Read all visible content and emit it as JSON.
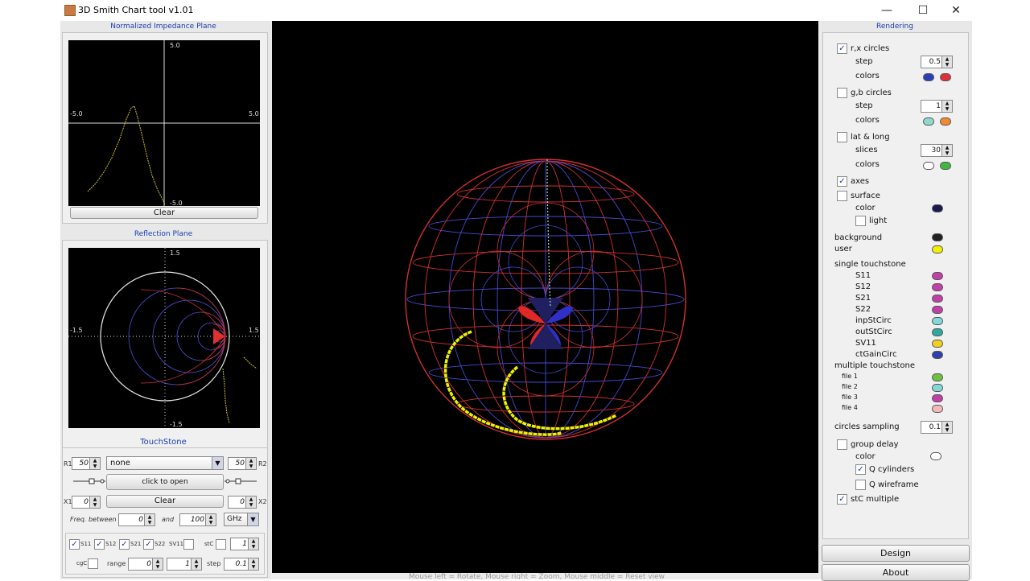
{
  "window": {
    "title": "3D Smith Chart tool v1.01",
    "controls": {
      "minimize": "—",
      "maximize": "☐",
      "close": "✕"
    }
  },
  "impedance_panel": {
    "title": "Normalized Impedance Plane",
    "ticks": {
      "top": "5.0",
      "bottom": "-5.0",
      "left": "-5.0",
      "right": "5.0"
    },
    "clear_label": "Clear"
  },
  "reflection_panel": {
    "title": "Reflection Plane",
    "ticks": {
      "top": "1.5",
      "bottom": "-1.5",
      "left": "-1.5",
      "right": "1.5"
    }
  },
  "touchstone": {
    "title": "TouchStone",
    "r1_label": "R1",
    "r1_value": "50",
    "file_select": "none",
    "r2_value": "50",
    "r2_label": "R2",
    "open_label": "click to open",
    "x1_label": "X1",
    "x1_value": "0",
    "clear_label": "Clear",
    "x2_value": "0",
    "x2_label": "X2",
    "freq_label": "Freq. between",
    "freq_from": "0",
    "and_label": "and",
    "freq_to": "100",
    "unit": "GHz",
    "s11": "S11",
    "s12": "S12",
    "s21": "S21",
    "s22": "S22",
    "sv11": "SV11",
    "stc": "stC",
    "stc_value": "1",
    "cgc": "cgC",
    "range_label": "range",
    "range_from": "0",
    "range_to": "1",
    "step_label": "step",
    "step_value": "0.1"
  },
  "status_bar": "Mouse left = Rotate, Mouse right = Zoom, Mouse middle = Reset view",
  "rendering": {
    "title": "Rendering",
    "rx_label": "r,x circles",
    "rx_step_label": "step",
    "rx_step": "0.5",
    "rx_colors_label": "colors",
    "gb_label": "g,b circles",
    "gb_step_label": "step",
    "gb_step": "1",
    "gb_colors_label": "colors",
    "latlong_label": "lat & long",
    "slices_label": "slices",
    "slices": "30",
    "ll_colors_label": "colors",
    "axes_label": "axes",
    "surface_label": "surface",
    "surface_color_label": "color",
    "light_label": "light",
    "background_label": "background",
    "user_label": "user",
    "single_touchstone_label": "single touchstone",
    "single_items": [
      "S11",
      "S12",
      "S21",
      "S22",
      "inpStCirc",
      "outStCirc",
      "SV11",
      "ctGainCirc"
    ],
    "multiple_touchstone_label": "multiple touchstone",
    "file_items": [
      "file 1",
      "file 2",
      "file 3",
      "file 4"
    ],
    "circles_sampling_label": "circles sampling",
    "circles_sampling": "0.1",
    "group_delay_label": "group delay",
    "gd_color_label": "color",
    "q_cylinders_label": "Q cylinders",
    "q_wireframe_label": "Q wireframe",
    "stc_multiple_label": "stC multiple",
    "design_label": "Design",
    "about_label": "About"
  },
  "colors": {
    "rx": [
      "#2b3fb8",
      "#e0303a"
    ],
    "gb": [
      "#8fd8d0",
      "#f08a30"
    ],
    "latlong": [
      "#ffffff",
      "#40b840"
    ],
    "surface": "#1a1a50",
    "background": "#222222",
    "user": "#f0f000",
    "single": [
      "#c040a8",
      "#c040a8",
      "#c040a8",
      "#c040a8",
      "#80d8d8",
      "#30a8a0",
      "#f0d020",
      "#3040b0"
    ],
    "files": [
      "#70c040",
      "#80d8d8",
      "#c040a8",
      "#f4b8b8"
    ],
    "group_delay": "#ffffff"
  }
}
